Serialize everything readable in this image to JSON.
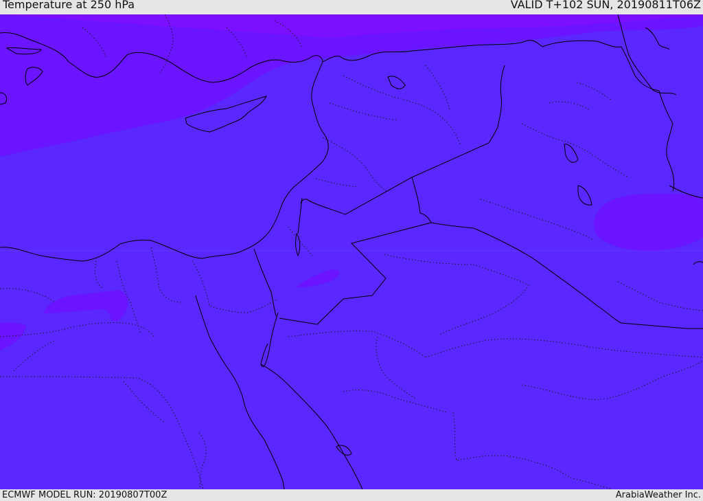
{
  "header": {
    "title": "Temperature at 250 hPa",
    "valid": "VALID T+102 SUN, 20190811T06Z"
  },
  "footer": {
    "model_run": "ECMWF MODEL RUN: 20190807T00Z",
    "brand": "ArabiaWeather Inc."
  },
  "colors": {
    "base_fill": "#5a27ff",
    "warm_band": "#6a14ff",
    "warmer_band": "#7a10ff",
    "border": "#000000",
    "frame_bg": "#e6e6e6"
  }
}
